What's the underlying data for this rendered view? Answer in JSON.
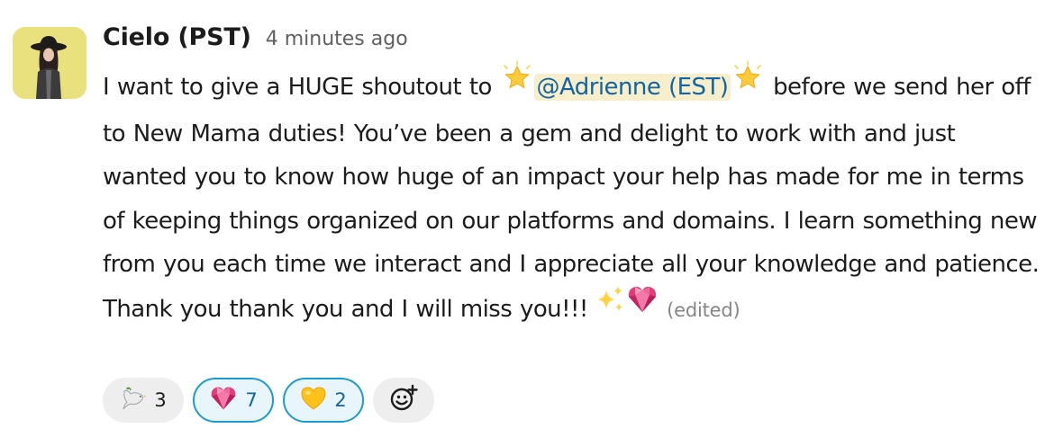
{
  "message": {
    "sender": "Cielo (PST)",
    "timestamp": "4 minutes ago",
    "text_before_mention": "I want to give a HUGE shoutout to ",
    "mention": "@Adrienne (EST)",
    "text_after_mention": " before we send her off to New Mama duties! You’ve been a gem and delight to work with and just wanted you to know how huge of an impact your help has made for me in terms of keeping things organized on our platforms and domains. I learn something new from you each time we interact and I appreciate all your knowledge and patience. Thank you thank you and I will miss you!!! ",
    "edited_label": "(edited)",
    "inline_emojis": [
      "glowing-star-icon",
      "glowing-star-icon",
      "sparkles-icon",
      "gem-heart-icon"
    ]
  },
  "reactions": [
    {
      "icon": "dove-icon",
      "count": "3",
      "active": false
    },
    {
      "icon": "gem-heart-icon",
      "count": "7",
      "active": true
    },
    {
      "icon": "yellow-heart-icon",
      "count": "2",
      "active": true
    }
  ],
  "add_reaction": {
    "icon": "add-reaction-icon"
  },
  "colors": {
    "mention_bg": "#f7efcc",
    "mention_text": "#1264a3",
    "reaction_active_border": "#1d9bd1",
    "reaction_active_bg": "#e8f5fa",
    "reaction_bg": "#eeeeee",
    "avatar_bg": "#e9e07e"
  }
}
